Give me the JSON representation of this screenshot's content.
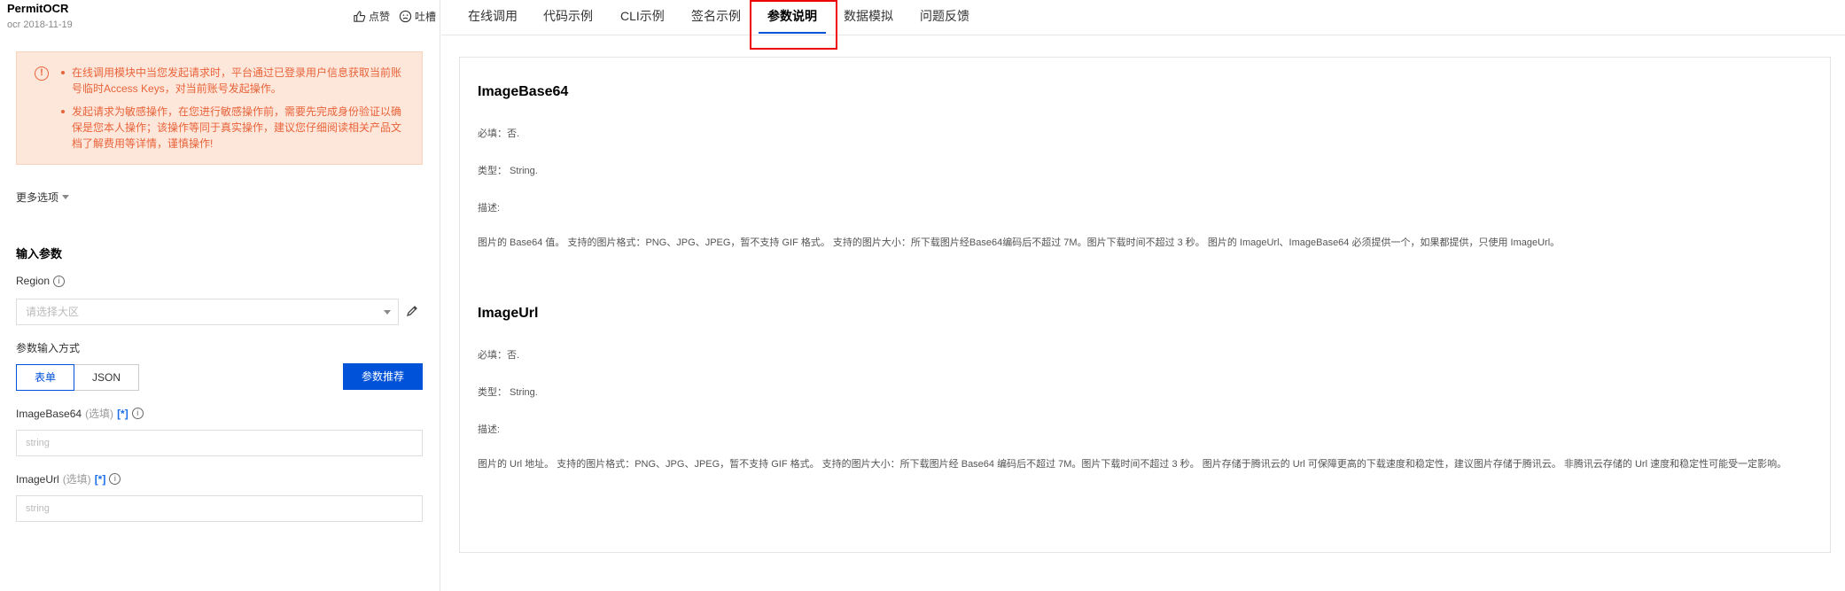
{
  "header": {
    "api_name": "PermitOCR",
    "api_sub": "ocr 2018-11-19",
    "like_label": "点赞",
    "complain_label": "吐槽"
  },
  "alert": {
    "items": [
      "在线调用模块中当您发起请求时，平台通过已登录用户信息获取当前账号临时Access Keys，对当前账号发起操作。",
      "发起请求为敏感操作，在您进行敏感操作前，需要先完成身份验证以确保是您本人操作；该操作等同于真实操作，建议您仔细阅读相关产品文档了解费用等详情，谨慎操作!"
    ]
  },
  "more_options": "更多选项",
  "input_section": {
    "title": "输入参数",
    "region_label": "Region",
    "region_placeholder": "请选择大区",
    "mode_label": "参数输入方式",
    "mode_form": "表单",
    "mode_json": "JSON",
    "recommend_button": "参数推荐",
    "fields": [
      {
        "name": "ImageBase64",
        "optional": "(选填)",
        "star": "[*]",
        "placeholder": "string"
      },
      {
        "name": "ImageUrl",
        "optional": "(选填)",
        "star": "[*]",
        "placeholder": "string"
      }
    ]
  },
  "tabs": [
    "在线调用",
    "代码示例",
    "CLI示例",
    "签名示例",
    "参数说明",
    "数据模拟",
    "问题反馈"
  ],
  "active_tab": "参数说明",
  "params": [
    {
      "name": "ImageBase64",
      "required": "必填：否.",
      "type": "类型： String.",
      "desc_label": "描述:",
      "desc": "图片的 Base64 值。 支持的图片格式：PNG、JPG、JPEG，暂不支持 GIF 格式。 支持的图片大小：所下载图片经Base64编码后不超过 7M。图片下载时间不超过 3 秒。 图片的 ImageUrl、ImageBase64 必须提供一个，如果都提供，只使用 ImageUrl。"
    },
    {
      "name": "ImageUrl",
      "required": "必填：否.",
      "type": "类型： String.",
      "desc_label": "描述:",
      "desc": "图片的 Url 地址。 支持的图片格式：PNG、JPG、JPEG，暂不支持 GIF 格式。 支持的图片大小：所下载图片经 Base64 编码后不超过 7M。图片下载时间不超过 3 秒。 图片存储于腾讯云的 Url 可保障更高的下载速度和稳定性，建议图片存储于腾讯云。 非腾讯云存储的 Url 速度和稳定性可能受一定影响。"
    }
  ],
  "colors": {
    "accent": "#0052d9",
    "alert_bg": "#fde7db",
    "alert_text": "#e8633a",
    "highlight": "#ee0000"
  }
}
